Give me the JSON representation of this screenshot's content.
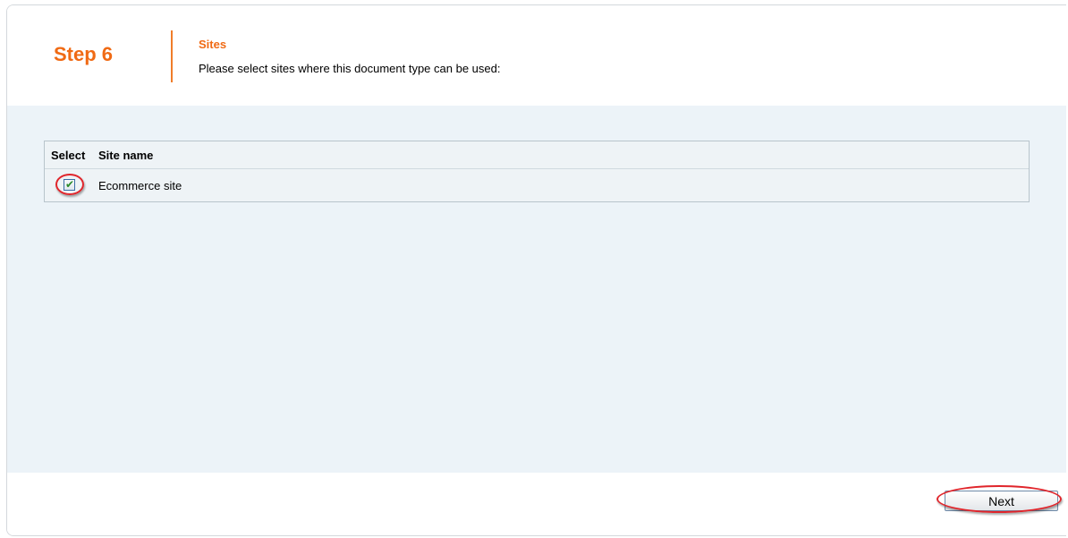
{
  "wizard": {
    "step_label": "Step 6",
    "title": "Sites",
    "description": "Please select sites where this document type can be used:"
  },
  "grid": {
    "columns": [
      "Select",
      "Site name"
    ],
    "rows": [
      {
        "selected": true,
        "site_name": "Ecommerce site"
      }
    ]
  },
  "footer": {
    "next_label": "Next"
  },
  "colors": {
    "accent": "#f06a14",
    "content_bg": "#ecf3f8",
    "highlight_ring": "#e0252b"
  },
  "icons": {
    "checkbox_mark": "check-icon"
  }
}
